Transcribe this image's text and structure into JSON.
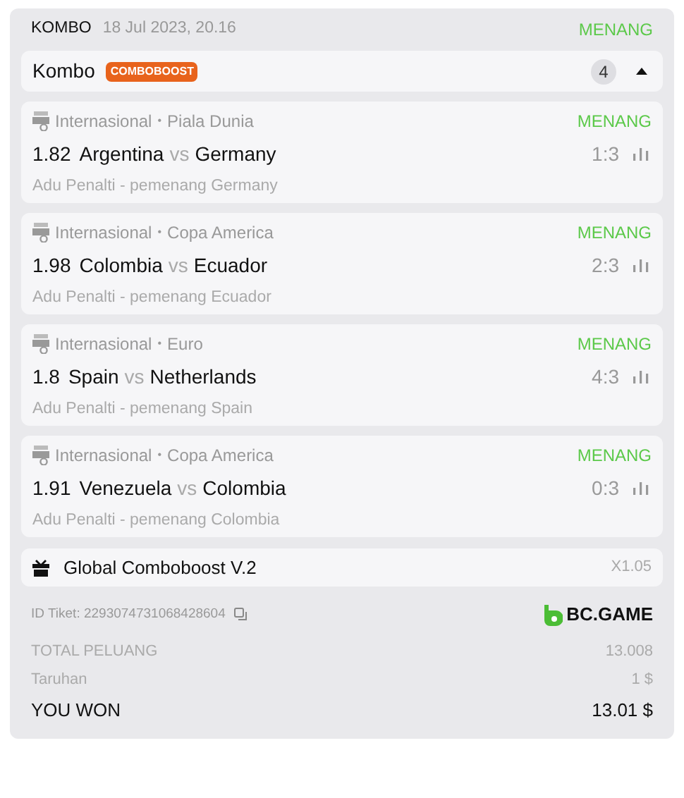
{
  "header": {
    "type": "KOMBO",
    "date": "18 Jul 2023, 20.16",
    "status": "MENANG"
  },
  "combo": {
    "title": "Kombo",
    "badge": "COMBOBOOST",
    "count": "4",
    "expanded": true
  },
  "matches": [
    {
      "category": "Internasional",
      "separator": "•",
      "league": "Piala Dunia",
      "status": "MENANG",
      "odds": "1.82",
      "home": "Argentina",
      "vs": "vs",
      "away": "Germany",
      "score": "1:3",
      "market": "Adu Penalti - pemenang Germany"
    },
    {
      "category": "Internasional",
      "separator": "•",
      "league": "Copa America",
      "status": "MENANG",
      "odds": "1.98",
      "home": "Colombia",
      "vs": "vs",
      "away": "Ecuador",
      "score": "2:3",
      "market": "Adu Penalti - pemenang Ecuador"
    },
    {
      "category": "Internasional",
      "separator": "•",
      "league": "Euro",
      "status": "MENANG",
      "odds": "1.8",
      "home": "Spain",
      "vs": "vs",
      "away": "Netherlands",
      "score": "4:3",
      "market": "Adu Penalti - pemenang Spain"
    },
    {
      "category": "Internasional",
      "separator": "•",
      "league": "Copa America",
      "status": "MENANG",
      "odds": "1.91",
      "home": "Venezuela",
      "vs": "vs",
      "away": "Colombia",
      "score": "0:3",
      "market": "Adu Penalti - pemenang Colombia"
    }
  ],
  "boost": {
    "label": "Global Comboboost V.2",
    "multiplier": "X1.05"
  },
  "ticket": {
    "id": "ID Tiket: 2293074731068428604",
    "brand": "BC.GAME"
  },
  "totals": [
    {
      "kind": "muted",
      "label": "TOTAL PELUANG",
      "value": "13.008"
    },
    {
      "kind": "muted",
      "label": "Taruhan",
      "value": "1 $"
    },
    {
      "kind": "strong",
      "label": "YOU WON",
      "value": "13.01 $"
    }
  ]
}
